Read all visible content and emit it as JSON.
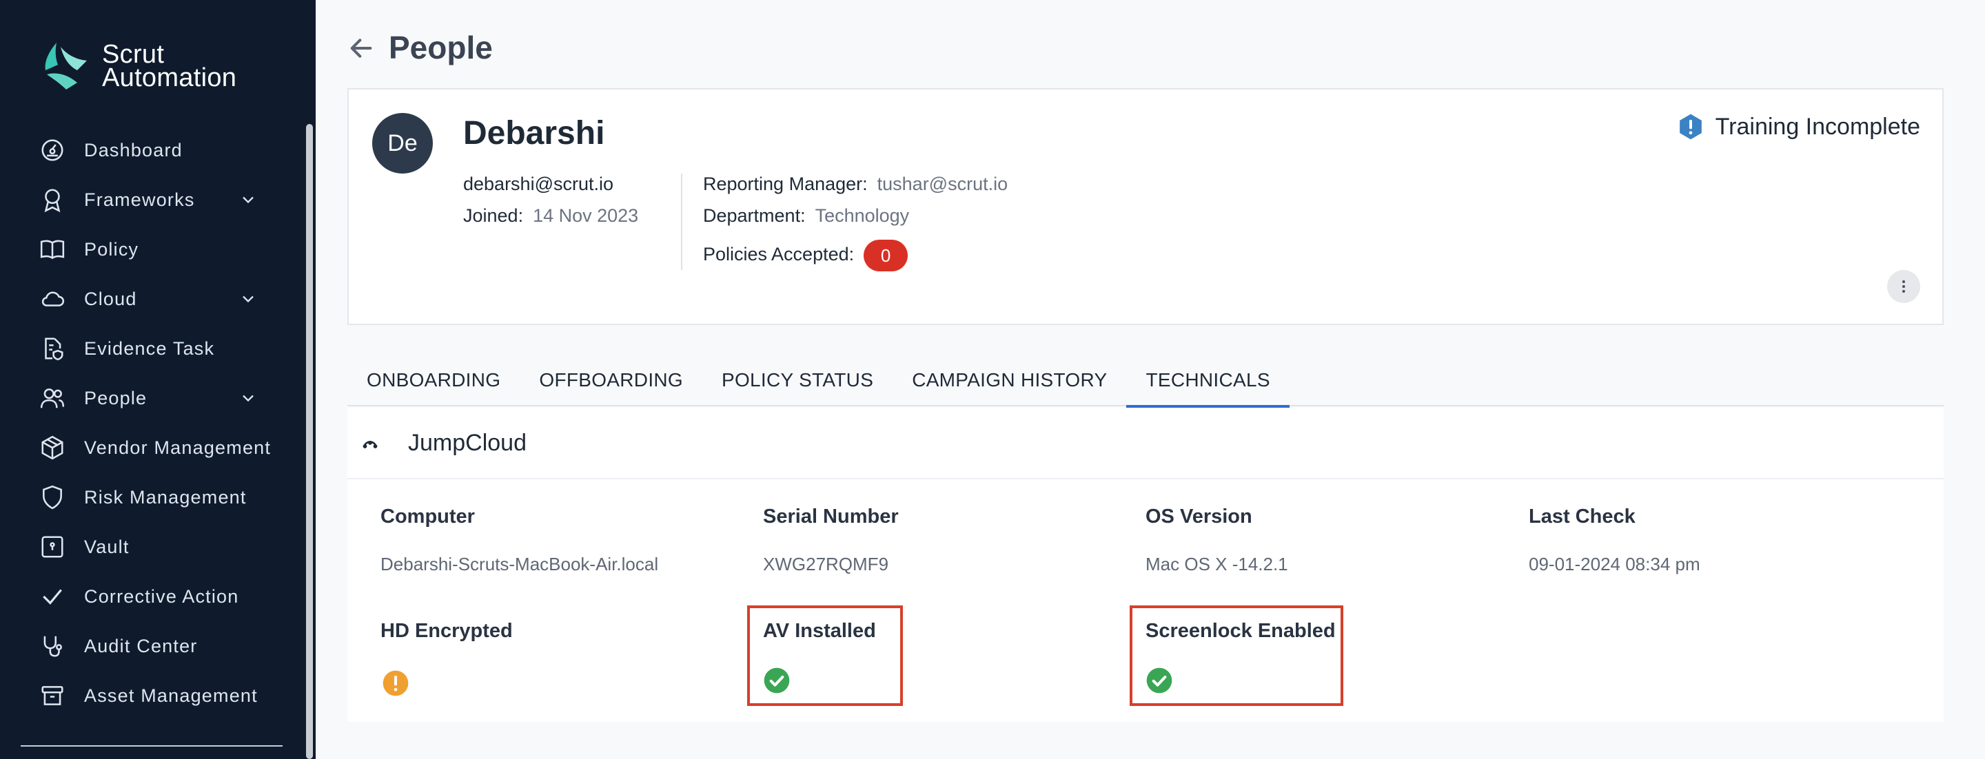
{
  "brand": {
    "line1": "Scrut",
    "line2": "Automation",
    "colors": {
      "teal": "#39c6b4",
      "sidebar_bg": "#0f1b2d"
    }
  },
  "sidebar": {
    "items": [
      {
        "label": "Dashboard",
        "icon": "dashboard-icon",
        "has_chevron": false
      },
      {
        "label": "Frameworks",
        "icon": "award-icon",
        "has_chevron": true
      },
      {
        "label": "Policy",
        "icon": "book-icon",
        "has_chevron": false
      },
      {
        "label": "Cloud",
        "icon": "cloud-icon",
        "has_chevron": true
      },
      {
        "label": "Evidence Task",
        "icon": "document-shield-icon",
        "has_chevron": false
      },
      {
        "label": "People",
        "icon": "people-icon",
        "has_chevron": true
      },
      {
        "label": "Vendor Management",
        "icon": "box-icon",
        "has_chevron": false
      },
      {
        "label": "Risk Management",
        "icon": "shield-icon",
        "has_chevron": false
      },
      {
        "label": "Vault",
        "icon": "vault-icon",
        "has_chevron": false
      },
      {
        "label": "Corrective Action",
        "icon": "check-icon",
        "has_chevron": false
      },
      {
        "label": "Audit Center",
        "icon": "stethoscope-icon",
        "has_chevron": false
      },
      {
        "label": "Asset Management",
        "icon": "archive-icon",
        "has_chevron": false
      }
    ]
  },
  "header": {
    "title": "People"
  },
  "profile": {
    "initials": "De",
    "name": "Debarshi",
    "email": "debarshi@scrut.io",
    "joined_label": "Joined:",
    "joined_value": "14 Nov 2023",
    "reporting_manager_label": "Reporting Manager:",
    "reporting_manager_value": "tushar@scrut.io",
    "department_label": "Department:",
    "department_value": "Technology",
    "policies_accepted_label": "Policies Accepted:",
    "policies_accepted_value": "0",
    "training_status": "Training Incomplete"
  },
  "tabs": [
    {
      "label": "ONBOARDING",
      "active": false
    },
    {
      "label": "OFFBOARDING",
      "active": false
    },
    {
      "label": "POLICY STATUS",
      "active": false
    },
    {
      "label": "CAMPAIGN HISTORY",
      "active": false
    },
    {
      "label": "TECHNICALS",
      "active": true
    }
  ],
  "technicals": {
    "section_title": "JumpCloud",
    "fields": {
      "computer_label": "Computer",
      "computer_value": "Debarshi-Scruts-MacBook-Air.local",
      "serial_label": "Serial Number",
      "serial_value": "XWG27RQMF9",
      "os_label": "OS Version",
      "os_value": "Mac OS X -14.2.1",
      "last_check_label": "Last Check",
      "last_check_value": "09-01-2024 08:34 pm",
      "hd_label": "HD Encrypted",
      "hd_status": "warning",
      "av_label": "AV Installed",
      "av_status": "ok",
      "screenlock_label": "Screenlock Enabled",
      "screenlock_status": "ok"
    },
    "status_colors": {
      "ok": "#3aa655",
      "warning": "#f0a030"
    }
  }
}
